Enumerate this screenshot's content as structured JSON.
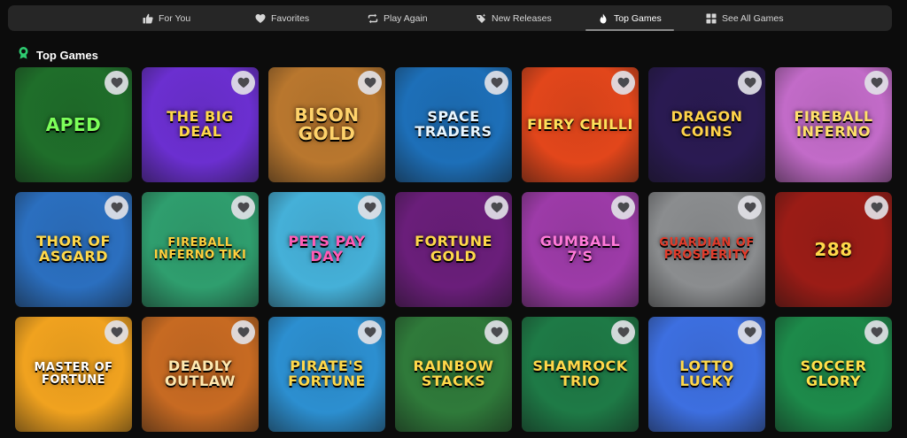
{
  "tabs": [
    {
      "label": "For You",
      "icon": "thumbs-up-icon",
      "active": false
    },
    {
      "label": "Favorites",
      "icon": "heart-icon",
      "active": false
    },
    {
      "label": "Play Again",
      "icon": "repeat-icon",
      "active": false
    },
    {
      "label": "New Releases",
      "icon": "sparkle-tag-icon",
      "active": false
    },
    {
      "label": "Top Games",
      "icon": "flame-icon",
      "active": true
    },
    {
      "label": "See All Games",
      "icon": "grid-icon",
      "active": false
    }
  ],
  "section": {
    "title": "Top Games",
    "icon": "award-badge-icon",
    "accent": "#2ecc71"
  },
  "games": [
    {
      "name": "APED",
      "bg": "#1f6e2a",
      "fg": "#7dff5a"
    },
    {
      "name": "The Big Deal",
      "bg": "#6b2fd0",
      "fg": "#ffd84a"
    },
    {
      "name": "Bison Gold",
      "bg": "#b9772e",
      "fg": "#ffd36b"
    },
    {
      "name": "Space Traders",
      "bg": "#1d6fb8",
      "fg": "#e8f6ff"
    },
    {
      "name": "Fiery Chilli",
      "bg": "#e2461b",
      "fg": "#ffe05a"
    },
    {
      "name": "Dragon Coins",
      "bg": "#2a1a52",
      "fg": "#ffd34a"
    },
    {
      "name": "Fireball Inferno",
      "bg": "#c26bc8",
      "fg": "#ffe06b"
    },
    {
      "name": "Thor of Asgard",
      "bg": "#2b6fbf",
      "fg": "#ffd84a"
    },
    {
      "name": "Fireball Inferno Tiki",
      "bg": "#2f9e6e",
      "fg": "#ffcf3d"
    },
    {
      "name": "Pets Pay Day",
      "bg": "#45b0d8",
      "fg": "#ff5bb5"
    },
    {
      "name": "Fortune Gold",
      "bg": "#6a1e7a",
      "fg": "#ffd84a"
    },
    {
      "name": "Gumball 7's",
      "bg": "#9d3ba8",
      "fg": "#ff7ad9"
    },
    {
      "name": "Guardian of Prosperity",
      "bg": "#8b8d8f",
      "fg": "#e23b2a"
    },
    {
      "name": "288",
      "bg": "#9b1c16",
      "fg": "#ffd84a"
    },
    {
      "name": "Master of Fortune",
      "bg": "#f0a21f",
      "fg": "#ffffff"
    },
    {
      "name": "Deadly Outlaw",
      "bg": "#c76a22",
      "fg": "#ffe9b0"
    },
    {
      "name": "Pirate's Fortune",
      "bg": "#2c8fd0",
      "fg": "#ffd84a"
    },
    {
      "name": "Rainbow Stacks",
      "bg": "#2f7a3a",
      "fg": "#ffd84a"
    },
    {
      "name": "Shamrock Trio",
      "bg": "#1e7a46",
      "fg": "#ffd84a"
    },
    {
      "name": "Lotto Lucky",
      "bg": "#3d6fe0",
      "fg": "#ffd84a"
    },
    {
      "name": "Soccer Glory",
      "bg": "#1d8a4a",
      "fg": "#ffe04a"
    }
  ]
}
